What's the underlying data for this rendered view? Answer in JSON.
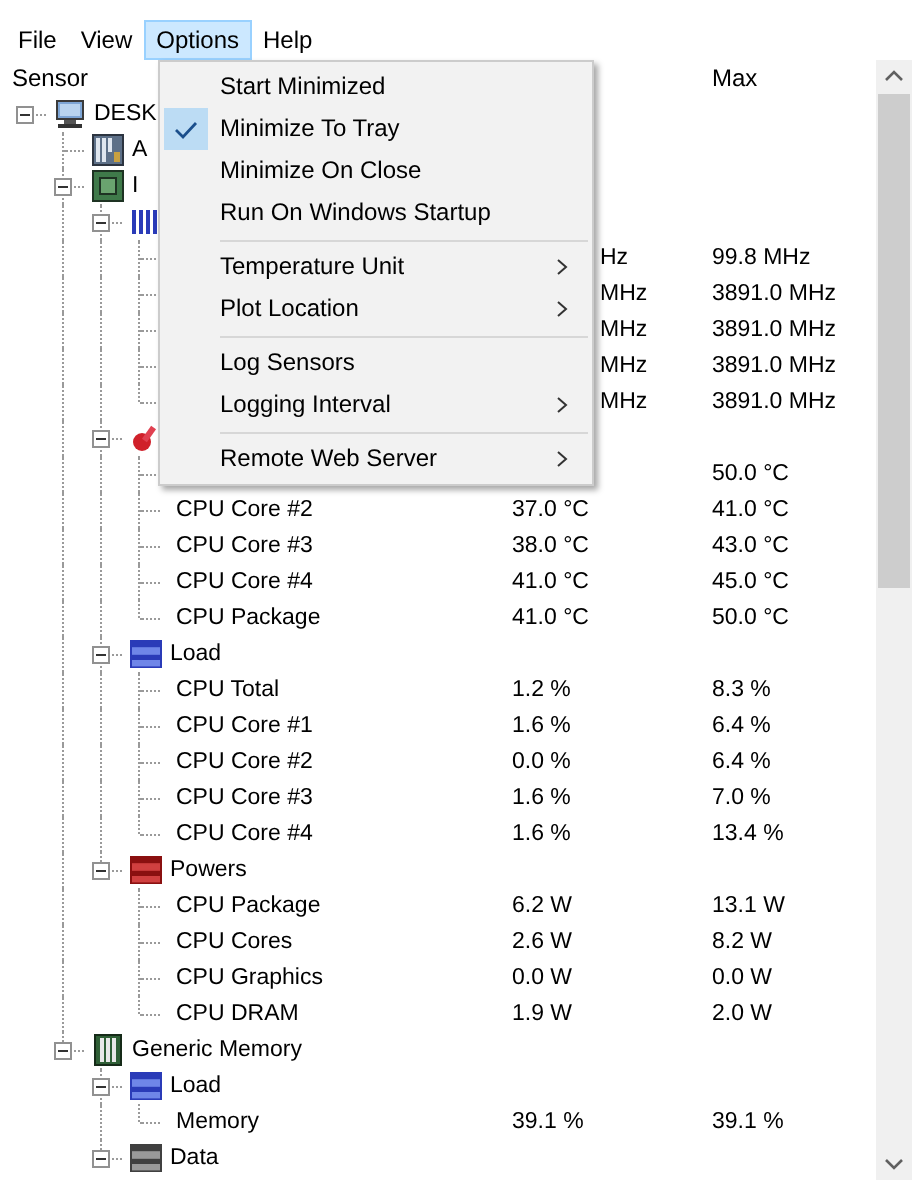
{
  "menu_bar": [
    {
      "label": "File",
      "selected": false
    },
    {
      "label": "View",
      "selected": false
    },
    {
      "label": "Options",
      "selected": true
    },
    {
      "label": "Help",
      "selected": false
    }
  ],
  "columns": {
    "sensor": "Sensor",
    "max": "Max"
  },
  "tree": [
    {
      "kind": "computer",
      "name": "DESK",
      "expanded": true,
      "children": [
        {
          "kind": "mainboard",
          "name": "A"
        },
        {
          "kind": "cpu",
          "name": "I",
          "expanded": true,
          "children": [
            {
              "kind": "clock",
              "expanded": true,
              "children": [
                {
                  "value": "Hz",
                  "max": "99.8 MHz",
                  "covered": true
                },
                {
                  "value": "MHz",
                  "max": "3891.0 MHz",
                  "covered": true
                },
                {
                  "value": "MHz",
                  "max": "3891.0 MHz",
                  "covered": true
                },
                {
                  "value": "MHz",
                  "max": "3891.0 MHz",
                  "covered": true
                },
                {
                  "value": "MHz",
                  "max": "3891.0 MHz",
                  "covered": true
                }
              ]
            },
            {
              "kind": "temperature",
              "expanded": true,
              "children": [
                {
                  "max": "50.0 °C"
                },
                {
                  "name": "CPU Core #2",
                  "value": "37.0 °C",
                  "max": "41.0 °C"
                },
                {
                  "name": "CPU Core #3",
                  "value": "38.0 °C",
                  "max": "43.0 °C"
                },
                {
                  "name": "CPU Core #4",
                  "value": "41.0 °C",
                  "max": "45.0 °C"
                },
                {
                  "name": "CPU Package",
                  "value": "41.0 °C",
                  "max": "50.0 °C"
                }
              ]
            },
            {
              "kind": "load",
              "name": "Load",
              "expanded": true,
              "children": [
                {
                  "name": "CPU Total",
                  "value": "1.2 %",
                  "max": "8.3 %"
                },
                {
                  "name": "CPU Core #1",
                  "value": "1.6 %",
                  "max": "6.4 %"
                },
                {
                  "name": "CPU Core #2",
                  "value": "0.0 %",
                  "max": "6.4 %"
                },
                {
                  "name": "CPU Core #3",
                  "value": "1.6 %",
                  "max": "7.0 %"
                },
                {
                  "name": "CPU Core #4",
                  "value": "1.6 %",
                  "max": "13.4 %"
                }
              ]
            },
            {
              "kind": "power",
              "name": "Powers",
              "expanded": true,
              "children": [
                {
                  "name": "CPU Package",
                  "value": "6.2 W",
                  "max": "13.1 W"
                },
                {
                  "name": "CPU Cores",
                  "value": "2.6 W",
                  "max": "8.2 W"
                },
                {
                  "name": "CPU Graphics",
                  "value": "0.0 W",
                  "max": "0.0 W"
                },
                {
                  "name": "CPU DRAM",
                  "value": "1.9 W",
                  "max": "2.0 W"
                }
              ]
            }
          ]
        },
        {
          "kind": "memory",
          "name": "Generic Memory",
          "expanded": true,
          "children": [
            {
              "kind": "load",
              "name": "Load",
              "expanded": true,
              "children": [
                {
                  "name": "Memory",
                  "value": "39.1 %",
                  "max": "39.1 %"
                }
              ]
            },
            {
              "kind": "data",
              "name": "Data",
              "expanded": true
            }
          ]
        }
      ]
    }
  ],
  "options_menu": [
    {
      "kind": "item",
      "label": "Start Minimized",
      "checked": false,
      "submenu": false
    },
    {
      "kind": "item",
      "label": "Minimize To Tray",
      "checked": true,
      "submenu": false
    },
    {
      "kind": "item",
      "label": "Minimize On Close",
      "checked": false,
      "submenu": false
    },
    {
      "kind": "item",
      "label": "Run On Windows Startup",
      "checked": false,
      "submenu": false
    },
    {
      "kind": "separator"
    },
    {
      "kind": "item",
      "label": "Temperature Unit",
      "checked": false,
      "submenu": true
    },
    {
      "kind": "item",
      "label": "Plot Location",
      "checked": false,
      "submenu": true
    },
    {
      "kind": "separator"
    },
    {
      "kind": "item",
      "label": "Log Sensors",
      "checked": false,
      "submenu": false
    },
    {
      "kind": "item",
      "label": "Logging Interval",
      "checked": false,
      "submenu": true
    },
    {
      "kind": "separator"
    },
    {
      "kind": "item",
      "label": "Remote Web Server",
      "checked": false,
      "submenu": true
    }
  ]
}
